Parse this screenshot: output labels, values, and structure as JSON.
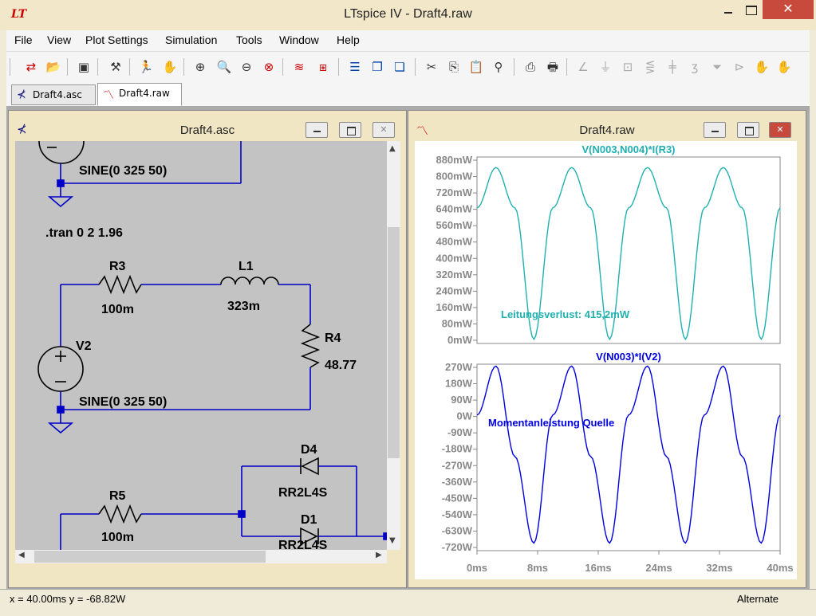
{
  "app": {
    "title": "LTspice IV - Draft4.raw",
    "logo": "LT"
  },
  "window_controls": {
    "close": "✕"
  },
  "menu": [
    "File",
    "View",
    "Plot Settings",
    "Simulation",
    "Tools",
    "Window",
    "Help"
  ],
  "toolbar_icons": [
    "new-schematic-icon",
    "open-icon",
    "save-icon",
    "control-panel-icon",
    "run-icon",
    "pan-hand-icon",
    "zoom-in-icon",
    "zoom-box-icon",
    "zoom-out-icon",
    "zoom-fit-icon",
    "autorange-icon",
    "pick-visible-icon",
    "tile-horizontal-icon",
    "cascade-icon",
    "tile-vertical-icon",
    "cut-icon",
    "copy-icon",
    "paste-icon",
    "find-icon",
    "print-setup-icon",
    "print-icon",
    "wire-icon",
    "ground-icon",
    "label-icon",
    "resistor-icon",
    "capacitor-icon",
    "inductor-icon",
    "diode-icon",
    "component-icon",
    "rotate-hand-icon",
    "mirror-hand-icon"
  ],
  "tabs": [
    {
      "label": "Draft4.asc"
    },
    {
      "label": "Draft4.raw"
    }
  ],
  "schematic_window": {
    "title": "Draft4.asc",
    "labels": {
      "v1_value": "SINE(0 325 50)",
      "tran": ".tran 0 2 1.96",
      "r3_name": "R3",
      "r3_value": "100m",
      "l1_name": "L1",
      "l1_value": "323m",
      "r4_name": "R4",
      "r4_value": "48.77",
      "v2_name": "V2",
      "v2_value": "SINE(0 325 50)",
      "d4_name": "D4",
      "d4_model": "RR2L4S",
      "r5_name": "R5",
      "r5_value": "100m",
      "d1_name": "D1",
      "d1_model": "RR2L4S"
    }
  },
  "plot_window": {
    "title": "Draft4.raw",
    "pane_top": {
      "trace": "V(N003,N004)*I(R3)",
      "annotation": "Leitungsverlust: 415,2mW",
      "color": "#20b0b0",
      "y_ticks": [
        "880mW",
        "800mW",
        "720mW",
        "640mW",
        "560mW",
        "480mW",
        "400mW",
        "320mW",
        "240mW",
        "160mW",
        "80mW",
        "0mW"
      ]
    },
    "pane_bottom": {
      "trace": "V(N003)*I(V2)",
      "annotation": "Momentanleistung Quelle",
      "color": "#0000e0",
      "y_ticks": [
        "270W",
        "180W",
        "90W",
        "0W",
        "-90W",
        "-180W",
        "-270W",
        "-360W",
        "-450W",
        "-540W",
        "-630W",
        "-720W"
      ]
    },
    "x_ticks": [
      "0ms",
      "8ms",
      "16ms",
      "24ms",
      "32ms",
      "40ms"
    ]
  },
  "chart_data": [
    {
      "type": "line",
      "title": "V(N003,N004)*I(R3)",
      "xlabel": "",
      "ylabel": "",
      "x_unit": "ms",
      "xlim": [
        0,
        40
      ],
      "y_unit": "mW",
      "ylim": [
        0,
        880
      ],
      "grid": false,
      "series": [
        {
          "name": "V(N003,N004)*I(R3)",
          "x": [
            0,
            2.5,
            5,
            7.5,
            10,
            12.5,
            15,
            17.5,
            20,
            22.5,
            25,
            27.5,
            30,
            32.5,
            35,
            37.5,
            40
          ],
          "values": [
            640,
            830,
            640,
            20,
            640,
            830,
            640,
            20,
            640,
            830,
            640,
            20,
            640,
            830,
            640,
            20,
            640
          ]
        }
      ]
    },
    {
      "type": "line",
      "title": "V(N003)*I(V2)",
      "xlabel": "",
      "ylabel": "",
      "x_unit": "ms",
      "xlim": [
        0,
        40
      ],
      "y_unit": "W",
      "ylim": [
        -720,
        270
      ],
      "grid": false,
      "series": [
        {
          "name": "V(N003)*I(V2)",
          "x": [
            0,
            2.5,
            5,
            7.5,
            10,
            12.5,
            15,
            17.5,
            20,
            22.5,
            25,
            27.5,
            30,
            32.5,
            35,
            37.5,
            40
          ],
          "values": [
            0,
            260,
            -220,
            -680,
            0,
            260,
            -220,
            -680,
            0,
            260,
            -220,
            -680,
            0,
            260,
            -220,
            -680,
            0
          ]
        }
      ]
    }
  ],
  "status": {
    "xy": "x = 40.00ms    y = -68.82W",
    "mode": "Alternate"
  }
}
